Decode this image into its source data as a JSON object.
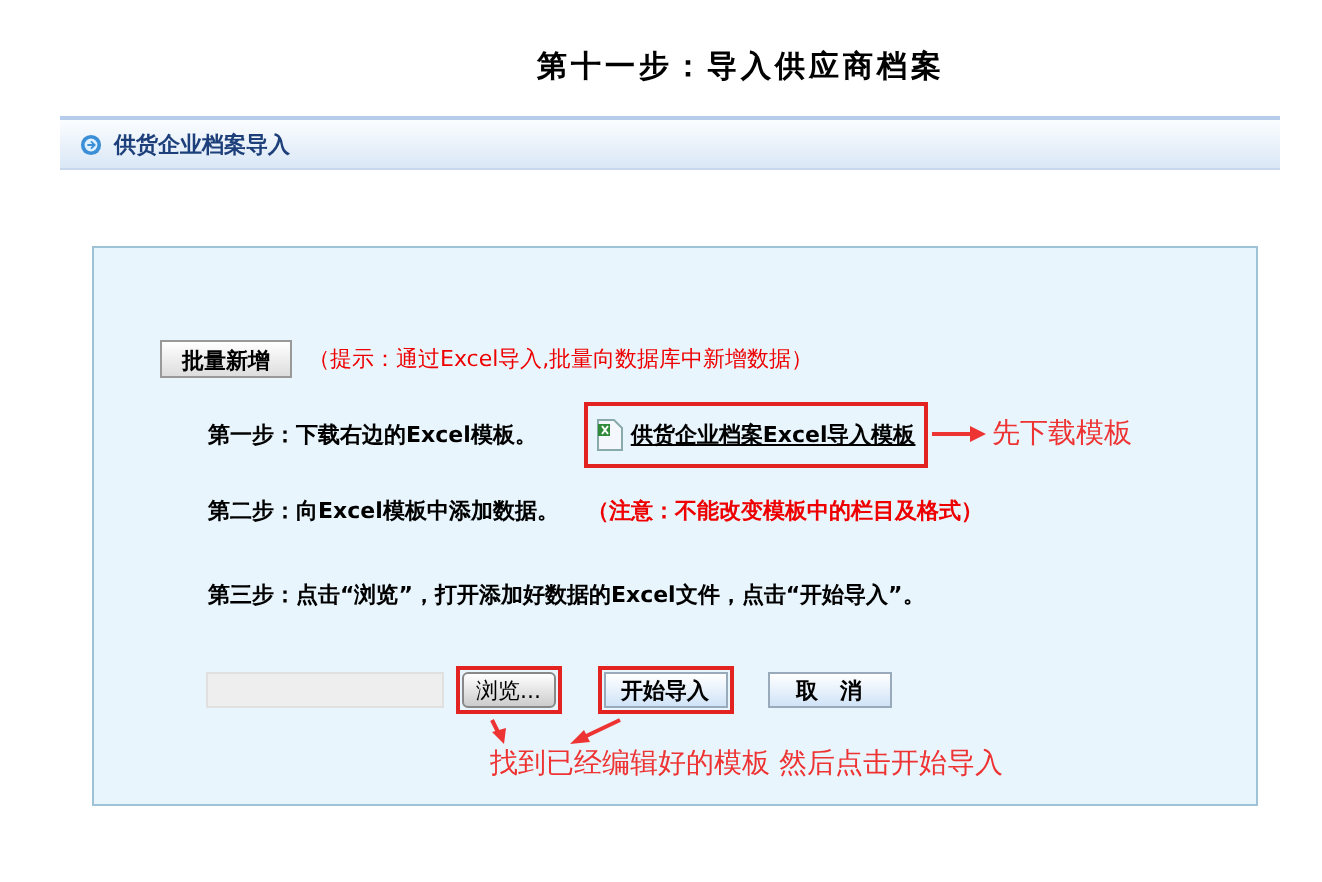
{
  "title": "第十一步：导入供应商档案",
  "section": {
    "title": "供货企业档案导入"
  },
  "batch": {
    "button": "批量新增",
    "hint": "（提示：通过Excel导入,批量向数据库中新增数据）"
  },
  "steps": [
    {
      "kind": "download",
      "label": "第一步：下载右边的Excel模板。",
      "link": "供货企业档案Excel导入模板",
      "highlighted": true,
      "annotation": "先下载模板"
    },
    {
      "kind": "note",
      "label": "第二步：向Excel模板中添加数据。",
      "note": "（注意：不能改变模板中的栏目及格式）"
    },
    {
      "kind": "plain",
      "label": "第三步：点击“浏览”，打开添加好数据的Excel文件，点击“开始导入”。"
    }
  ],
  "file_field": {
    "browse": "浏览...",
    "highlighted": true
  },
  "buttons": [
    {
      "label": "开始导入",
      "highlighted": true
    },
    {
      "label": "取　消",
      "highlighted": false
    }
  ],
  "annotation": "找到已经编辑好的模板  然后点击开始导入"
}
